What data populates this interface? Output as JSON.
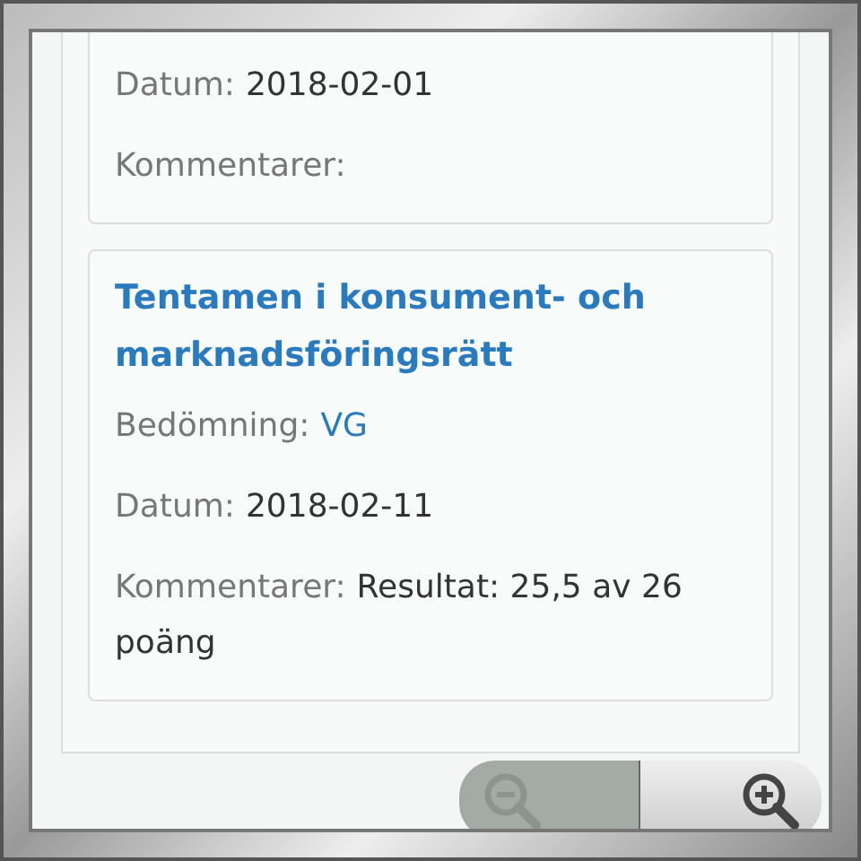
{
  "cards": [
    {
      "fields": [
        {
          "label": "Datum:",
          "value": "2018-02-01",
          "kind": "plain"
        },
        {
          "label": "Kommentarer:"
        }
      ]
    },
    {
      "title": "Tentamen i konsument- och marknadsföringsrätt",
      "fields": [
        {
          "label": "Bedömning:",
          "value": "VG",
          "kind": "grade"
        },
        {
          "label": "Datum:",
          "value": "2018-02-11",
          "kind": "plain"
        },
        {
          "label": "Kommentarer:",
          "value": "Resultat: 25,5 av 26 poäng",
          "kind": "plain"
        }
      ]
    }
  ],
  "zoom_controls": [
    {
      "kind": "out",
      "disabled": true
    },
    {
      "kind": "in",
      "disabled": false
    }
  ]
}
